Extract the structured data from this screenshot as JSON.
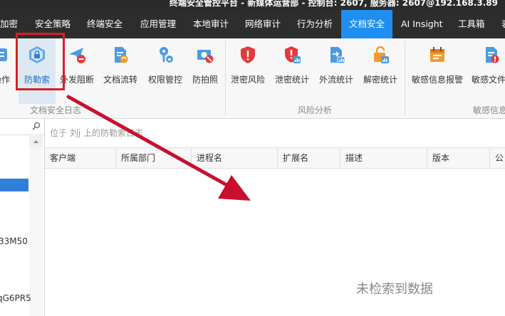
{
  "title": "终端安全管控平台 - 新媒体运营部 - 控制台: 2607, 服务器: 2607@192.168.3.89",
  "menu": [
    {
      "label": "加密"
    },
    {
      "label": "安全策略"
    },
    {
      "label": "终端安全"
    },
    {
      "label": "应用管理"
    },
    {
      "label": "本地审计"
    },
    {
      "label": "网络审计"
    },
    {
      "label": "行为分析"
    },
    {
      "label": "文档安全",
      "active": true
    },
    {
      "label": "AI Insight"
    },
    {
      "label": "工具箱"
    },
    {
      "label": "表"
    }
  ],
  "ribbon": {
    "buttons": [
      {
        "label": "操作",
        "icon": "operation-icon"
      },
      {
        "label": "防勒索",
        "icon": "ransomware-shield-icon",
        "active": true
      },
      {
        "label": "外发阻断",
        "icon": "block-send-icon"
      },
      {
        "label": "文档流转",
        "icon": "document-flow-icon"
      },
      {
        "label": "权限管控",
        "icon": "permission-icon"
      },
      {
        "label": "防拍照",
        "icon": "anti-photo-icon"
      },
      {
        "label": "泄密风险",
        "icon": "leak-risk-icon"
      },
      {
        "label": "泄密统计",
        "icon": "leak-stats-icon"
      },
      {
        "label": "外流统计",
        "icon": "outflow-stats-icon"
      },
      {
        "label": "解密统计",
        "icon": "decrypt-stats-icon"
      },
      {
        "label": "敏感信息报警",
        "icon": "sensitive-alert-icon"
      },
      {
        "label": "敏感文件",
        "icon": "sensitive-file-icon"
      }
    ],
    "groups": [
      {
        "label": "文档安全日志"
      },
      {
        "label": "风险分析"
      },
      {
        "label": "敏感信息"
      }
    ]
  },
  "sidebar": {
    "items": [
      {
        "label": "33M50"
      },
      {
        "label": "qG6PR5"
      }
    ]
  },
  "main": {
    "breadcrumb": "位于 刘j 上的防勒索日志",
    "columns": [
      "客户端",
      "所属部门",
      "进程名",
      "扩展名",
      "描述",
      "版本",
      "公"
    ],
    "empty_text": "未检索到数据"
  },
  "colors": {
    "accent": "#1f8ef1",
    "highlight_box": "#d61f26",
    "annotation_arrow": "#c8102e",
    "selection": "#2f7ed8"
  }
}
